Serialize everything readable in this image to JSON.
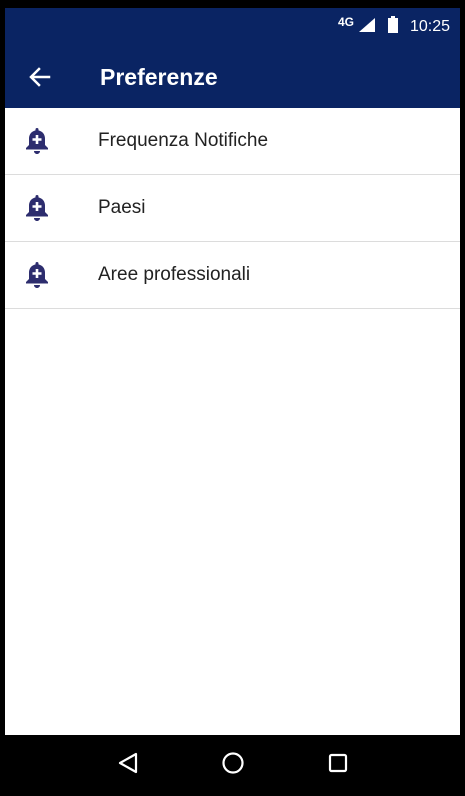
{
  "status_bar": {
    "network": "4G",
    "time": "10:25"
  },
  "app_bar": {
    "title": "Preferenze",
    "back_icon": "arrow-left-icon",
    "color": "#0a2463"
  },
  "list": {
    "items": [
      {
        "label": "Frequenza Notifiche",
        "icon": "bell-plus-icon"
      },
      {
        "label": "Paesi",
        "icon": "bell-plus-icon"
      },
      {
        "label": "Aree professionali",
        "icon": "bell-plus-icon"
      }
    ],
    "icon_color": "#2d2d6e"
  },
  "nav_bar": {
    "back_icon": "triangle-back-icon",
    "home_icon": "circle-home-icon",
    "recents_icon": "square-recents-icon"
  }
}
